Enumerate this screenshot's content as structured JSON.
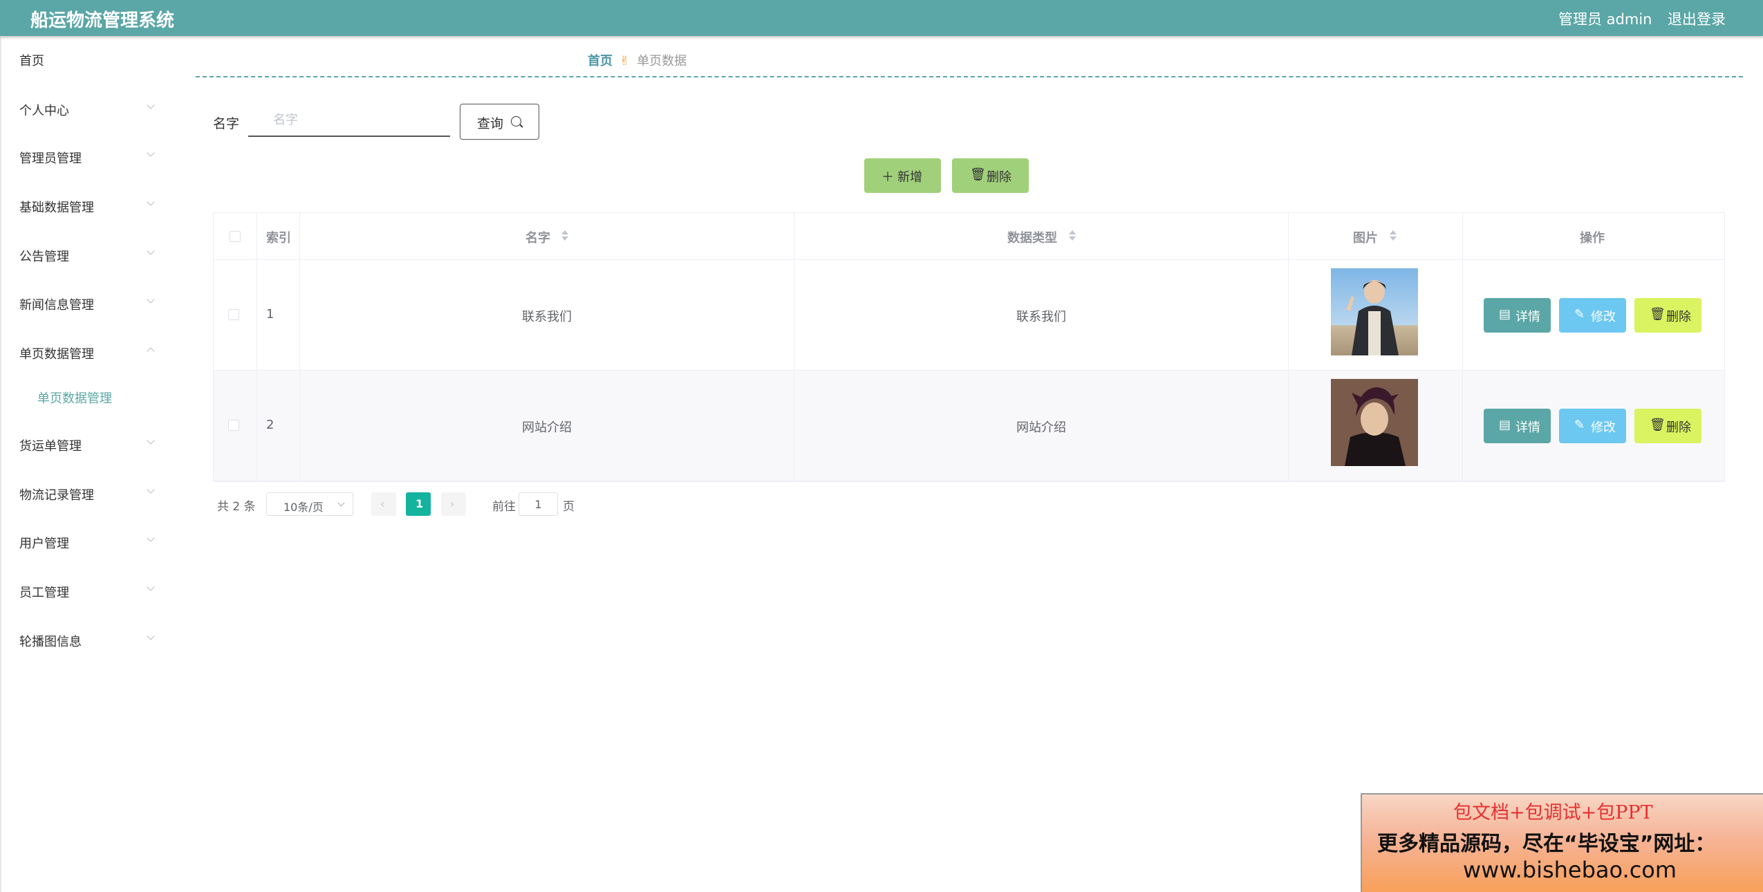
{
  "header": {
    "title": "船运物流管理系统",
    "user": "管理员 admin",
    "logout": "退出登录"
  },
  "sidebar": {
    "items": [
      {
        "label": "首页"
      },
      {
        "label": "个人中心"
      },
      {
        "label": "管理员管理"
      },
      {
        "label": "基础数据管理"
      },
      {
        "label": "公告管理"
      },
      {
        "label": "新闻信息管理"
      },
      {
        "label": "单页数据管理"
      },
      {
        "label": "货运单管理"
      },
      {
        "label": "物流记录管理"
      },
      {
        "label": "用户管理"
      },
      {
        "label": "员工管理"
      },
      {
        "label": "轮播图信息"
      }
    ],
    "submenu": {
      "label": "单页数据管理"
    }
  },
  "breadcrumb": {
    "home": "首页",
    "separator": "✌",
    "current": "单页数据"
  },
  "search": {
    "label": "名字",
    "placeholder": "名字",
    "button": "查询"
  },
  "actions": {
    "add": "新增",
    "delete": "删除"
  },
  "table": {
    "headers": {
      "index": "索引",
      "name": "名字",
      "type": "数据类型",
      "image": "图片",
      "ops": "操作"
    },
    "rows": [
      {
        "index": "1",
        "name": "联系我们",
        "type": "联系我们"
      },
      {
        "index": "2",
        "name": "网站介绍",
        "type": "网站介绍"
      }
    ],
    "ops": {
      "detail": "详情",
      "edit": "修改",
      "delete": "删除"
    }
  },
  "pagination": {
    "total": "共 2 条",
    "page_size": "10条/页",
    "current": "1",
    "goto": "前往",
    "goto_value": "1",
    "page_unit": "页"
  },
  "ad": {
    "line1": "包文档+包调试+包PPT",
    "line2": "更多精品源码，尽在“毕设宝”网址：",
    "line3": "www.bishebao.com"
  }
}
